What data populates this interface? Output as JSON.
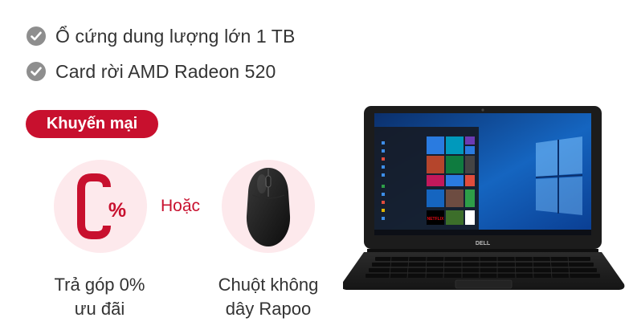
{
  "features": [
    {
      "icon": "check-circle-icon",
      "text": "Ổ cứng dung lượng lớn 1 TB"
    },
    {
      "icon": "check-circle-icon",
      "text": "Card rời AMD Radeon 520"
    }
  ],
  "promotion": {
    "badge_label": "Khuyến mại",
    "or_label": "Hoặc",
    "offers": [
      {
        "icon": "zero-percent-icon",
        "label_line1": "Trả góp 0%",
        "label_line2": "ưu đãi"
      },
      {
        "icon": "wireless-mouse-image",
        "label_line1": "Chuột không",
        "label_line2": "dây Rapoo"
      }
    ]
  },
  "product_image": {
    "subject": "Dell laptop",
    "bezel_logo": "DELL",
    "screen_tiles": [
      "NETFLIX"
    ]
  },
  "colors": {
    "accent": "#c8102e",
    "offer_circle_bg": "#fde9ec",
    "check_icon": "#8e8e8e",
    "text": "#333333"
  }
}
